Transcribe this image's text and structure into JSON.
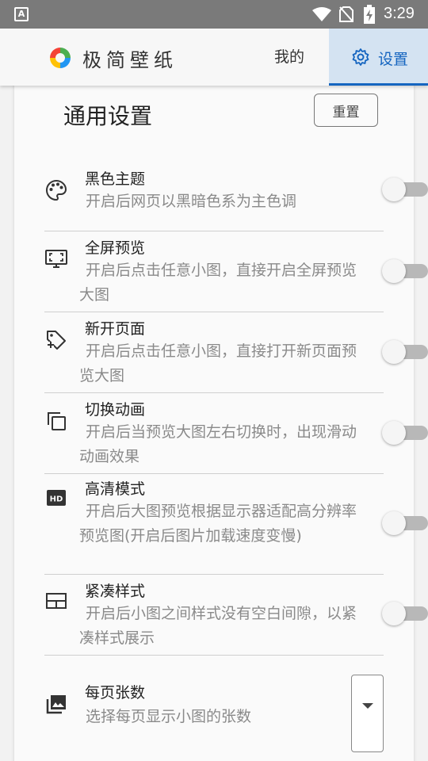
{
  "status_bar": {
    "time": "3:29",
    "notification_icon_letter": "A"
  },
  "header": {
    "app_title": "极简壁纸",
    "tabs": [
      {
        "label": "我的",
        "active": false
      },
      {
        "label": "设置",
        "active": true,
        "icon": "gear-icon"
      }
    ]
  },
  "settings": {
    "section_title": "通用设置",
    "reset_label": "重置",
    "items": [
      {
        "title": "黑色主题",
        "desc": "开启后网页以黑暗色系为主色调",
        "icon": "palette-icon",
        "enabled": false
      },
      {
        "title": "全屏预览",
        "desc": "开启后点击任意小图，直接开启全屏预览大图",
        "icon": "fullscreen-monitor-icon",
        "enabled": false
      },
      {
        "title": "新开页面",
        "desc": "开启后点击任意小图，直接打开新页面预览大图",
        "icon": "new-tab-icon",
        "enabled": false
      },
      {
        "title": "切换动画",
        "desc": "开启后当预览大图左右切换时，出现滑动动画效果",
        "icon": "copy-layers-icon",
        "enabled": false
      },
      {
        "title": "高清模式",
        "desc": "开启后大图预览根据显示器适配高分辨率预览图(开启后图片加载速度变慢)",
        "icon": "hd-icon",
        "enabled": false
      },
      {
        "title": "紧凑样式",
        "desc": "开启后小图之间样式没有空白间隙，以紧凑样式展示",
        "icon": "compact-layout-icon",
        "enabled": false
      }
    ],
    "per_page": {
      "title": "每页张数",
      "desc": "选择每页显示小图的张数",
      "icon": "photos-icon",
      "selected_value": ""
    }
  },
  "colors": {
    "accent": "#1565c0",
    "active_tab_bg": "#d4e3f2",
    "status_bar": "#7a7a7a"
  }
}
